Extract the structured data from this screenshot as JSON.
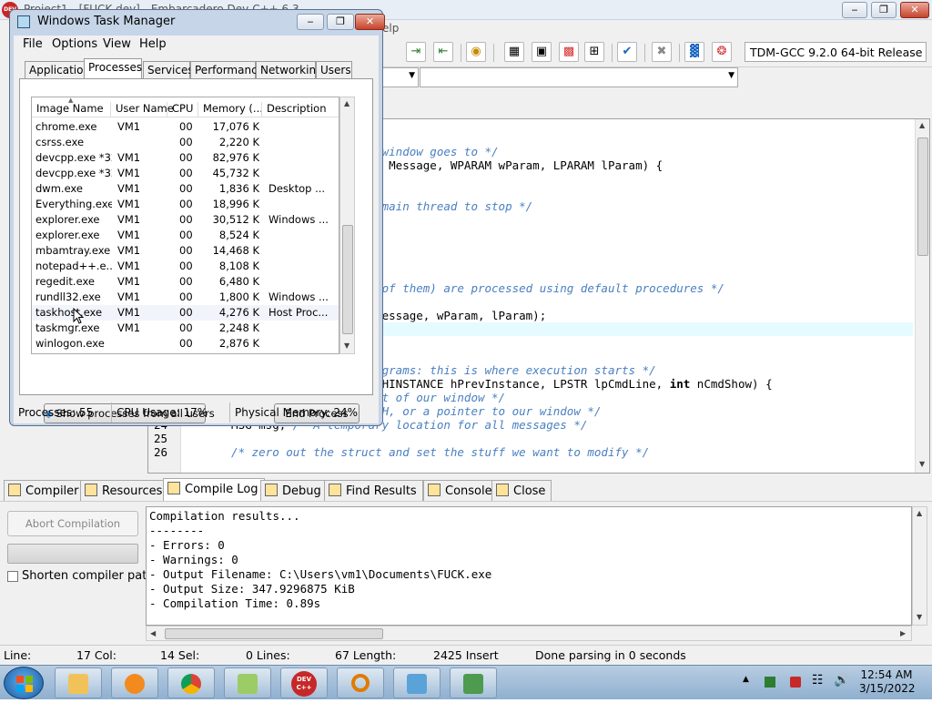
{
  "devcpp": {
    "title": "Project1 - [FUCK.dev] - Embarcadero Dev-C++ 6.3",
    "app_icon_text": "DEV",
    "menu_help_fragment": "elp",
    "compiler_select": "TDM-GCC 9.2.0 64-bit Release",
    "editor": {
      "lines": [
        {
          "ln": "",
          "parts": [
            {
              "t": "                 to the window goes to */",
              "c": "cmt"
            }
          ]
        },
        {
          "ln": "",
          "parts": [
            {
              "t": "              hwnd, UINT Message, WPARAM wParam, LPARAM lParam) {",
              "c": ""
            }
          ]
        },
        {
          "ln": "",
          "parts": []
        },
        {
          "ln": "",
          "parts": []
        },
        {
          "ln": "",
          "parts": [
            {
              "t": "                ell the main thread to stop */",
              "c": "cmt"
            }
          ]
        },
        {
          "ln": "",
          "parts": []
        },
        {
          "ln": "",
          "parts": [
            {
              "t": "                ;",
              "c": "cmt"
            }
          ]
        },
        {
          "ln": "",
          "parts": []
        },
        {
          "ln": "",
          "parts": []
        },
        {
          "ln": "",
          "parts": []
        },
        {
          "ln": "",
          "parts": [
            {
              "t": "                 (a lot of them) are processed using default procedures */",
              "c": "cmt"
            }
          ]
        },
        {
          "ln": "",
          "parts": []
        },
        {
          "ln": "",
          "parts": [
            {
              "t": "              oc(hwnd, Message, wParam, lParam);",
              "c": ""
            }
          ]
        },
        {
          "ln": "",
          "parts": [],
          "hl": true
        },
        {
          "ln": "",
          "parts": []
        },
        {
          "ln": "",
          "parts": []
        },
        {
          "ln": "",
          "parts": [
            {
              "t": "               2 GUI programs: this is where execution starts */",
              "c": "cmt"
            }
          ]
        },
        {
          "ln": "",
          "parts": [
            {
              "t": "              Instance, HINSTANCE hPrevInstance, LPSTR lpCmdLine, ",
              "c": ""
            },
            {
              "t": "int",
              "c": "kw"
            },
            {
              "t": " nCmdShow) {",
              "c": ""
            }
          ]
        },
        {
          "ln": "",
          "parts": [
            {
              "t": "              ties struct of our window */",
              "c": "cmt"
            }
          ]
        },
        {
          "ln": "",
          "parts": [
            {
              "t": "              hence the H, or a pointer to our window */",
              "c": "cmt"
            }
          ]
        },
        {
          "ln": "24",
          "parts": [
            {
              "t": "  MSG msg; ",
              "c": ""
            },
            {
              "t": "/* A temporary location for all messages */",
              "c": "cmt"
            }
          ]
        },
        {
          "ln": "25",
          "parts": []
        },
        {
          "ln": "26",
          "parts": [
            {
              "t": "  /* zero out the struct and set the stuff we want to modify */",
              "c": "cmt"
            }
          ]
        }
      ]
    },
    "bottom_tabs": [
      {
        "label": "Compiler",
        "active": false
      },
      {
        "label": "Resources",
        "active": false
      },
      {
        "label": "Compile Log",
        "active": true
      },
      {
        "label": "Debug",
        "active": false
      },
      {
        "label": "Find Results",
        "active": false
      },
      {
        "label": "Console",
        "active": false
      },
      {
        "label": "Close",
        "active": false
      }
    ],
    "abort_label": "Abort Compilation",
    "shorten_label": "Shorten compiler paths",
    "log_lines": [
      "Compilation results...",
      "--------",
      "- Errors: 0",
      "- Warnings: 0",
      "- Output Filename: C:\\Users\\vm1\\Documents\\FUCK.exe",
      "- Output Size: 347.9296875 KiB",
      "- Compilation Time: 0.89s"
    ],
    "status": {
      "line": "Line:",
      "col": "17 Col:",
      "sel": "14 Sel:",
      "lines": "0 Lines:",
      "length": "67 Length:",
      "insert": "2425 Insert",
      "parse": "Done parsing in 0 seconds"
    }
  },
  "taskmgr": {
    "title": "Windows Task Manager",
    "menu": [
      "File",
      "Options",
      "View",
      "Help"
    ],
    "tabs": [
      "Applications",
      "Processes",
      "Services",
      "Performance",
      "Networking",
      "Users"
    ],
    "active_tab": "Processes",
    "columns": [
      "Image Name",
      "User Name",
      "CPU",
      "Memory (...",
      "Description"
    ],
    "processes": [
      {
        "name": "chrome.exe",
        "user": "VM1",
        "cpu": "00",
        "mem": "17,076 K",
        "desc": ""
      },
      {
        "name": "csrss.exe",
        "user": "",
        "cpu": "00",
        "mem": "2,220 K",
        "desc": ""
      },
      {
        "name": "devcpp.exe *32",
        "user": "VM1",
        "cpu": "00",
        "mem": "82,976 K",
        "desc": ""
      },
      {
        "name": "devcpp.exe *32",
        "user": "VM1",
        "cpu": "00",
        "mem": "45,732 K",
        "desc": ""
      },
      {
        "name": "dwm.exe",
        "user": "VM1",
        "cpu": "00",
        "mem": "1,836 K",
        "desc": "Desktop ..."
      },
      {
        "name": "Everything.exe",
        "user": "VM1",
        "cpu": "00",
        "mem": "18,996 K",
        "desc": ""
      },
      {
        "name": "explorer.exe",
        "user": "VM1",
        "cpu": "00",
        "mem": "30,512 K",
        "desc": "Windows ..."
      },
      {
        "name": "explorer.exe",
        "user": "VM1",
        "cpu": "00",
        "mem": "8,524 K",
        "desc": ""
      },
      {
        "name": "mbamtray.exe",
        "user": "VM1",
        "cpu": "00",
        "mem": "14,468 K",
        "desc": ""
      },
      {
        "name": "notepad++.e...",
        "user": "VM1",
        "cpu": "00",
        "mem": "8,108 K",
        "desc": ""
      },
      {
        "name": "regedit.exe",
        "user": "VM1",
        "cpu": "00",
        "mem": "6,480 K",
        "desc": ""
      },
      {
        "name": "rundll32.exe",
        "user": "VM1",
        "cpu": "00",
        "mem": "1,800 K",
        "desc": "Windows ..."
      },
      {
        "name": "taskhost.exe",
        "user": "VM1",
        "cpu": "00",
        "mem": "4,276 K",
        "desc": "Host Proc..."
      },
      {
        "name": "taskmgr.exe",
        "user": "VM1",
        "cpu": "00",
        "mem": "2,248 K",
        "desc": ""
      },
      {
        "name": "winlogon.exe",
        "user": "",
        "cpu": "00",
        "mem": "2,876 K",
        "desc": ""
      }
    ],
    "show_all_label": "Show processes from all users",
    "end_process_label": "End Process",
    "status": {
      "processes": "Processes: 55",
      "cpu": "CPU Usage: 17%",
      "memory": "Physical Memory: 24%"
    }
  },
  "taskbar": {
    "time": "12:54 AM",
    "date": "3/15/2022",
    "devcpp_icon_text": "DEV C++"
  },
  "colors": {
    "comment": "#4a7fc1",
    "line_highlight": "#e6fbff",
    "taskbar": "#8fb0d0"
  }
}
